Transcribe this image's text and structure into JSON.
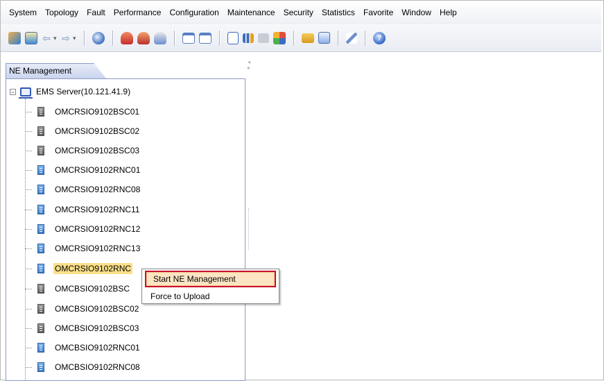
{
  "menubar": {
    "items": [
      {
        "label": "System"
      },
      {
        "label": "Topology"
      },
      {
        "label": "Fault"
      },
      {
        "label": "Performance"
      },
      {
        "label": "Configuration"
      },
      {
        "label": "Maintenance"
      },
      {
        "label": "Security"
      },
      {
        "label": "Statistics"
      },
      {
        "label": "Favorite"
      },
      {
        "label": "Window"
      },
      {
        "label": "Help"
      }
    ]
  },
  "toolbar": {
    "icons": [
      "topology-view-icon",
      "ne-list-icon",
      "back-arrow-icon",
      "forward-arrow-icon",
      "globe-icon",
      "alarm-red-icon",
      "alarm-orange-icon",
      "alarm-blue-icon",
      "window-icon",
      "window-search-icon",
      "document-icon",
      "chart-icon",
      "gray-box-icon",
      "multi-color-icon",
      "folder-icon",
      "note-icon",
      "pen-icon",
      "help-icon"
    ]
  },
  "tab": {
    "label": "NE Management"
  },
  "tree": {
    "root": "EMS Server(10.121.41.9)",
    "nodes": [
      {
        "label": "OMCRSIO9102BSC01",
        "kind": "bsc"
      },
      {
        "label": "OMCRSIO9102BSC02",
        "kind": "bsc"
      },
      {
        "label": "OMCRSIO9102BSC03",
        "kind": "bsc"
      },
      {
        "label": "OMCRSIO9102RNC01",
        "kind": "rnc"
      },
      {
        "label": "OMCRSIO9102RNC08",
        "kind": "rnc"
      },
      {
        "label": "OMCRSIO9102RNC11",
        "kind": "rnc"
      },
      {
        "label": "OMCRSIO9102RNC12",
        "kind": "rnc"
      },
      {
        "label": "OMCRSIO9102RNC13",
        "kind": "rnc"
      },
      {
        "label": "OMCRSIO9102RNC",
        "kind": "rnc",
        "selected": true
      },
      {
        "label": "OMCBSIO9102BSC",
        "kind": "bsc"
      },
      {
        "label": "OMCBSIO9102BSC02",
        "kind": "bsc"
      },
      {
        "label": "OMCBSIO9102BSC03",
        "kind": "bsc"
      },
      {
        "label": "OMCBSIO9102RNC01",
        "kind": "rnc"
      },
      {
        "label": "OMCBSIO9102RNC08",
        "kind": "rnc"
      }
    ]
  },
  "context_menu": {
    "items": [
      {
        "label": "Start NE Management",
        "highlighted": true
      },
      {
        "label": "Force to Upload"
      }
    ]
  },
  "colors": {
    "highlight_border": "#c8102e",
    "selection_fill": "#fbe08a",
    "menu_highlight": "#fde5c3"
  }
}
